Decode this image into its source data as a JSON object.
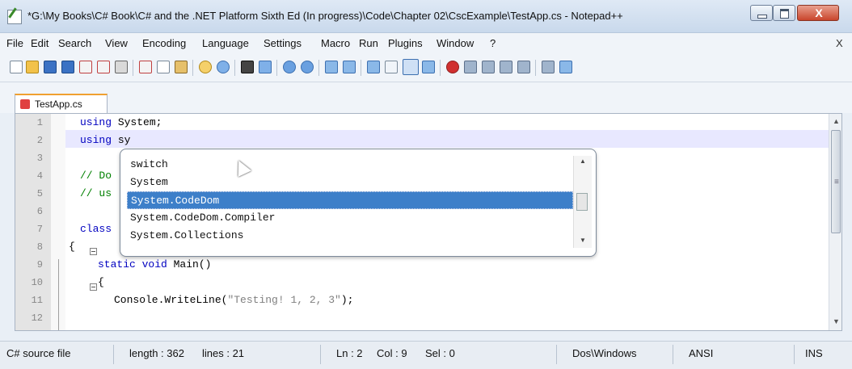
{
  "window": {
    "title": "*G:\\My Books\\C# Book\\C# and the .NET Platform Sixth Ed (In progress)\\Code\\Chapter 02\\CscExample\\TestApp.cs - Notepad++",
    "close_glyph": "X"
  },
  "menu": {
    "items": [
      "File",
      "Edit",
      "Search",
      "View",
      "Encoding",
      "Language",
      "Settings",
      "Macro",
      "Run",
      "Plugins",
      "Window",
      "?"
    ],
    "close_label": "X"
  },
  "tab": {
    "label": "TestApp.cs"
  },
  "editor": {
    "line_numbers": [
      "1",
      "2",
      "3",
      "4",
      "5",
      "6",
      "7",
      "8",
      "9",
      "10",
      "11",
      "12"
    ],
    "lines": {
      "l1_kw": "using",
      "l1_rest": " System;",
      "l2_kw": "using",
      "l2_rest": " sy",
      "l4": "// Do",
      "l5": "// us",
      "l7": "class",
      "l8": "{",
      "l9_kw": "static void",
      "l9_rest": " Main()",
      "l10": "{",
      "l11_a": "Console.WriteLine(",
      "l11_str": "\"Testing! 1, 2, 3\"",
      "l11_b": ");"
    }
  },
  "autocomplete": {
    "items": [
      "switch",
      "System",
      "System.CodeDom",
      "System.CodeDom.Compiler",
      "System.Collections"
    ],
    "selected": "System.CodeDom"
  },
  "statusbar": {
    "file_type": "C# source file",
    "length": "length : 362",
    "lines": "lines : 21",
    "ln": "Ln : 2",
    "col": "Col : 9",
    "sel": "Sel : 0",
    "eol": "Dos\\Windows",
    "encoding": "ANSI",
    "mode": "INS"
  },
  "colors": {
    "keyword": "#0000c0",
    "comment": "#008000",
    "string": "#808080",
    "selection": "#3d7fc9",
    "current_line": "#e8e8ff"
  }
}
